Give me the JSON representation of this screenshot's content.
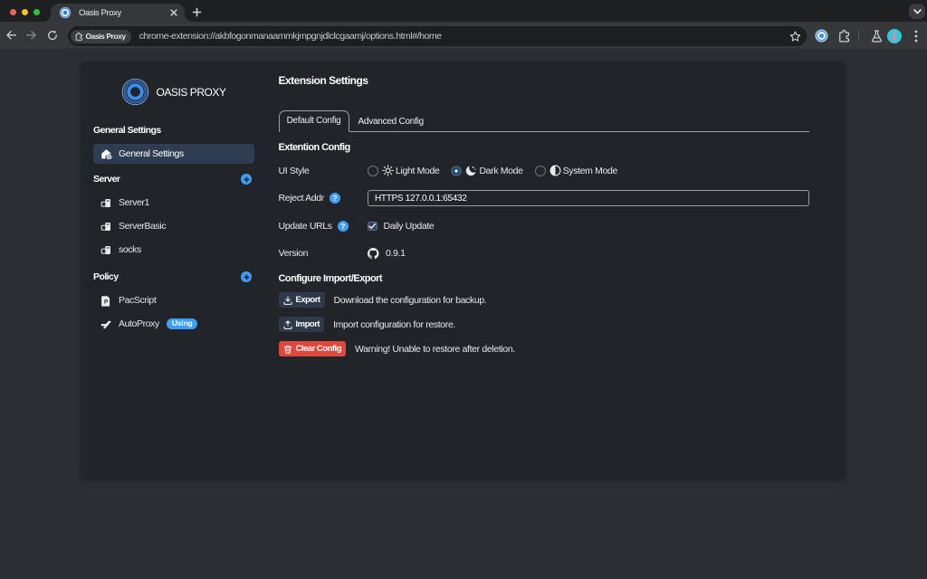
{
  "colors": {
    "accent_blue": "#409eff",
    "danger_red": "#e0483b",
    "card_bg": "#212428",
    "page_bg": "#2b2f34",
    "selected_item_bg": "#2f3d52"
  },
  "browser": {
    "tab": {
      "title": "Oasis Proxy",
      "close_icon": "x",
      "new_tab_icon": "+"
    },
    "address_bar": {
      "chip_label": "Oasis Proxy",
      "url": "chrome-extension://akbfogonmanaammkjmpgnjdlclcgaamj/options.html#/home"
    },
    "toolbar_icons": [
      "back-arrow",
      "forward-arrow",
      "reload",
      "bookmark-star",
      "oasis-extension",
      "extensions-puzzle",
      "labs-flask",
      "profile-avatar",
      "menu-kebab"
    ]
  },
  "sidebar": {
    "logo_text": "OASIS PROXY",
    "sections": [
      {
        "title": "General Settings",
        "items": [
          {
            "label": "General Settings",
            "selected": true
          }
        ]
      },
      {
        "title": "Server",
        "add_button": "+",
        "items": [
          {
            "label": "Server1"
          },
          {
            "label": "ServerBasic"
          },
          {
            "label": "socks"
          }
        ]
      },
      {
        "title": "Policy",
        "add_button": "+",
        "items": [
          {
            "label": "PacScript"
          },
          {
            "label": "AutoProxy",
            "badge": "Using"
          }
        ]
      }
    ]
  },
  "main": {
    "title": "Extension Settings",
    "tabs": [
      {
        "label": "Default Config",
        "active": true
      },
      {
        "label": "Advanced Config",
        "active": false
      }
    ],
    "config_section": {
      "heading": "Extention Config",
      "ui_style": {
        "label": "UI Style",
        "options": [
          {
            "label": "Light Mode",
            "icon": "sun",
            "selected": false
          },
          {
            "label": "Dark Mode",
            "icon": "moon",
            "selected": true
          },
          {
            "label": "System Mode",
            "icon": "half-circle",
            "selected": false
          }
        ]
      },
      "reject_addr": {
        "label": "Reject Addr",
        "help_icon": "?",
        "value": "HTTPS 127.0.0.1:65432"
      },
      "update_urls": {
        "label": "Update URLs",
        "help_icon": "?",
        "checkbox_label": "Daily Update",
        "checked": true
      },
      "version": {
        "label": "Version",
        "value": "0.9.1"
      }
    },
    "import_export_section": {
      "heading": "Configure Import/Export",
      "actions": [
        {
          "button": "Export",
          "icon": "download",
          "description": "Download the configuration for backup."
        },
        {
          "button": "Import",
          "icon": "upload",
          "description": "Import configuration for restore."
        },
        {
          "button": "Clear Config",
          "icon": "trash",
          "description": "Warning! Unable to restore after deletion.",
          "danger": true
        }
      ]
    }
  }
}
